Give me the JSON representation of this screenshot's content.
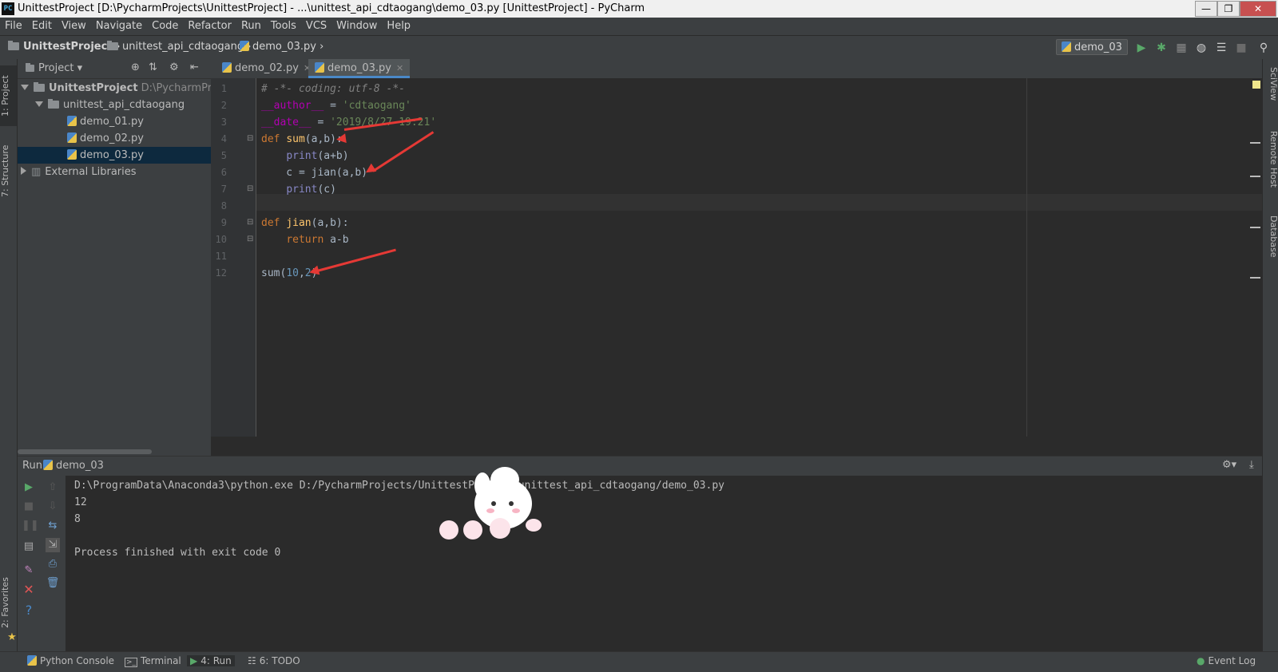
{
  "window": {
    "title": "UnittestProject [D:\\PycharmProjects\\UnittestProject] - ...\\unittest_api_cdtaogang\\demo_03.py [UnittestProject] - PyCharm",
    "app_icon_text": "PC",
    "minimize": "—",
    "maximize": "❐",
    "close": "✕"
  },
  "menu": [
    "File",
    "Edit",
    "View",
    "Navigate",
    "Code",
    "Refactor",
    "Run",
    "Tools",
    "VCS",
    "Window",
    "Help"
  ],
  "breadcrumb": {
    "project": "UnittestProject",
    "folder": "unittest_api_cdtaogang",
    "file": "demo_03.py"
  },
  "run_config": {
    "label": "demo_03"
  },
  "left_tabs": {
    "project": "1: Project",
    "structure": "7: Structure",
    "favorites": "2: Favorites"
  },
  "right_tabs": {
    "sciview": "SciView",
    "remote_host": "Remote Host",
    "database": "Database"
  },
  "project_panel": {
    "header": "Project",
    "root_name": "UnittestProject",
    "root_path": "D:\\PycharmProjec",
    "folder": "unittest_api_cdtaogang",
    "files": [
      "demo_01.py",
      "demo_02.py",
      "demo_03.py"
    ],
    "selected_file": "demo_03.py",
    "external": "External Libraries"
  },
  "editor_tabs": [
    {
      "label": "demo_02.py",
      "active": false
    },
    {
      "label": "demo_03.py",
      "active": true
    }
  ],
  "code_lines": {
    "l1": "# -*- coding: utf-8 -*-",
    "l2_a": "__author__",
    "l2_b": " = ",
    "l2_c": "'cdtaogang'",
    "l3_a": "__date__",
    "l3_b": " = ",
    "l3_c": "'2019/8/27 19:21'",
    "l4_kw": "def ",
    "l4_fn": "sum",
    "l4_rest": "(a,b):",
    "l5_pre": "    ",
    "l5_bi": "print",
    "l5_rest": "(a+b)",
    "l6": "    c = jian(a,b)",
    "l7_pre": "    ",
    "l7_bi": "print",
    "l7_rest": "(c)",
    "l9_kw": "def ",
    "l9_fn": "jian",
    "l9_rest": "(a,b):",
    "l10_pre": "    ",
    "l10_kw": "return",
    "l10_rest": " a-b",
    "l12_a": "sum(",
    "l12_n1": "10",
    "l12_c": ",",
    "l12_n2": "2",
    "l12_d": ")"
  },
  "line_numbers": [
    "1",
    "2",
    "3",
    "4",
    "5",
    "6",
    "7",
    "8",
    "9",
    "10",
    "11",
    "12"
  ],
  "run_panel": {
    "title": "Run",
    "config": "demo_03",
    "output": [
      "D:\\ProgramData\\Anaconda3\\python.exe D:/PycharmProjects/UnittestProject/unittest_api_cdtaogang/demo_03.py",
      "12",
      "8",
      "",
      "Process finished with exit code 0"
    ]
  },
  "bottom_tabs": {
    "python_console": "Python Console",
    "terminal": "Terminal",
    "run": "4: Run",
    "todo": "6: TODO",
    "event_log": "Event Log"
  },
  "colors": {
    "accent_blue": "#4a88c7",
    "run_green": "#59a869",
    "annotation_red": "#e53935"
  }
}
